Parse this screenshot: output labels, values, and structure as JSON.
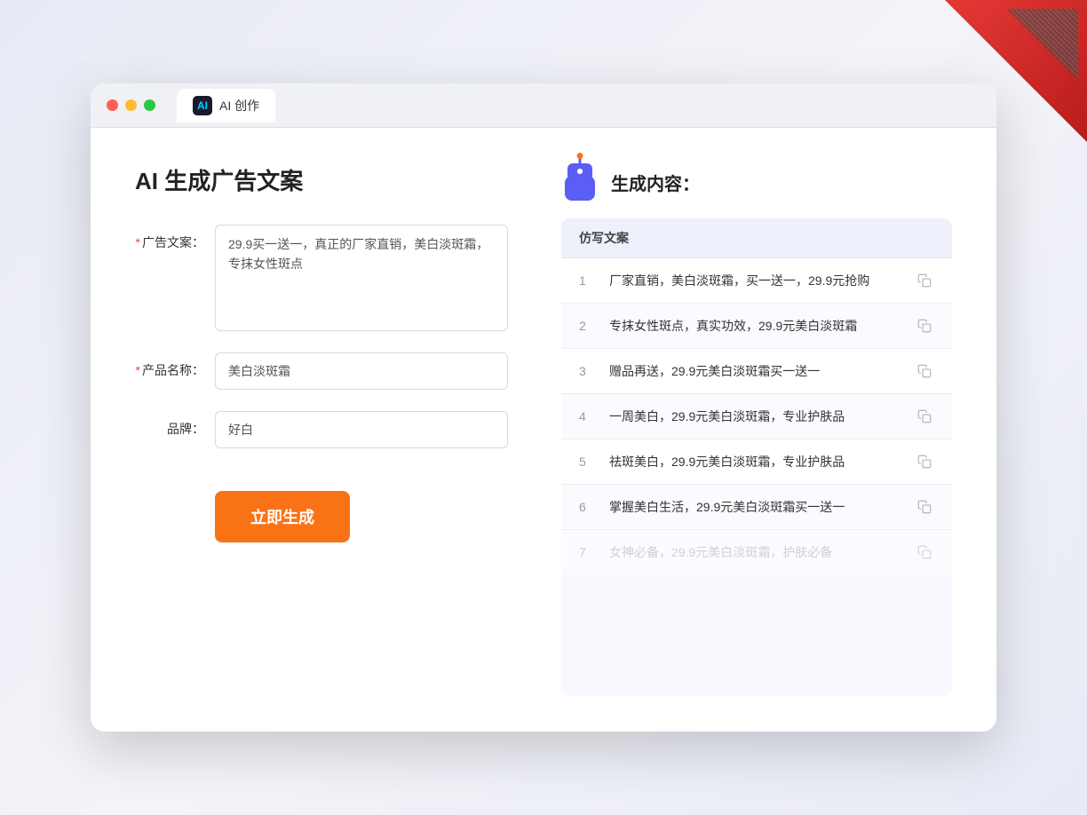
{
  "window": {
    "tab_icon_text": "AI",
    "tab_label": "AI 创作"
  },
  "left": {
    "page_title": "AI 生成广告文案",
    "fields": [
      {
        "id": "ad_copy",
        "label": "广告文案：",
        "required": true,
        "type": "textarea",
        "value": "29.9买一送一，真正的厂家直销，美白淡斑霜，专抹女性斑点"
      },
      {
        "id": "product_name",
        "label": "产品名称：",
        "required": true,
        "type": "input",
        "value": "美白淡斑霜"
      },
      {
        "id": "brand",
        "label": "品牌：",
        "required": false,
        "type": "input",
        "value": "好白"
      }
    ],
    "generate_button": "立即生成"
  },
  "right": {
    "header_title": "生成内容：",
    "table_header": "仿写文案",
    "results": [
      {
        "num": "1",
        "text": "厂家直销，美白淡斑霜，买一送一，29.9元抢购",
        "muted": false
      },
      {
        "num": "2",
        "text": "专抹女性斑点，真实功效，29.9元美白淡斑霜",
        "muted": false
      },
      {
        "num": "3",
        "text": "赠品再送，29.9元美白淡斑霜买一送一",
        "muted": false
      },
      {
        "num": "4",
        "text": "一周美白，29.9元美白淡斑霜，专业护肤品",
        "muted": false
      },
      {
        "num": "5",
        "text": "祛斑美白，29.9元美白淡斑霜，专业护肤品",
        "muted": false
      },
      {
        "num": "6",
        "text": "掌握美白生活，29.9元美白淡斑霜买一送一",
        "muted": false
      },
      {
        "num": "7",
        "text": "女神必备，29.9元美白淡斑霜，护肤必备",
        "muted": true
      }
    ]
  }
}
